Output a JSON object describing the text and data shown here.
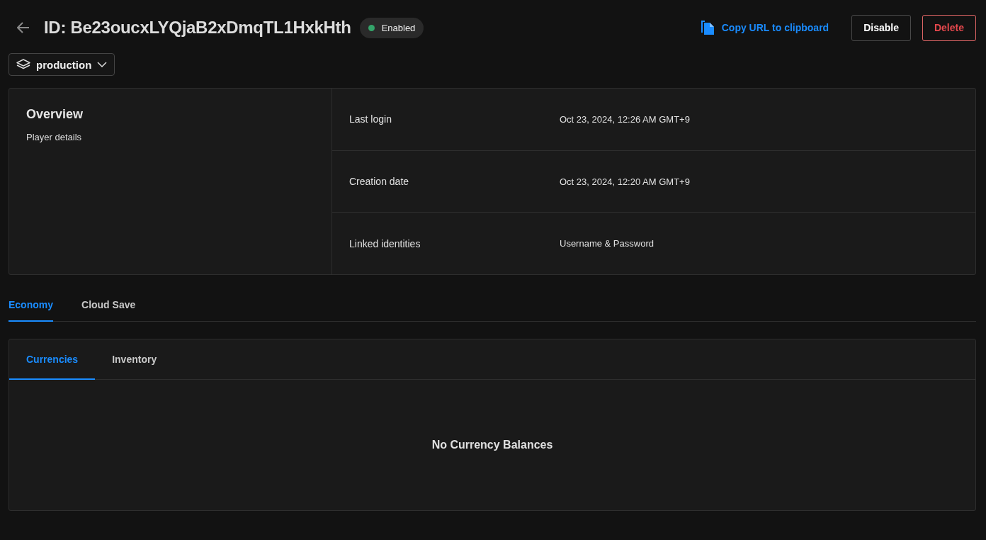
{
  "header": {
    "title": "ID: Be23oucxLYQjaB2xDmqTL1HxkHth",
    "status": {
      "label": "Enabled",
      "color": "#34a46a"
    },
    "copy_link": "Copy URL to clipboard",
    "buttons": [
      {
        "label": "Disable",
        "kind": "default"
      },
      {
        "label": "Delete",
        "kind": "danger"
      }
    ]
  },
  "environment": {
    "value": "production"
  },
  "overview": {
    "title": "Overview",
    "subtitle": "Player details",
    "fields": [
      {
        "label": "Last login",
        "value": "Oct 23, 2024, 12:26 AM GMT+9"
      },
      {
        "label": "Creation date",
        "value": "Oct 23, 2024, 12:20 AM GMT+9"
      },
      {
        "label": "Linked identities",
        "value": "Username & Password"
      }
    ]
  },
  "tabs": [
    {
      "label": "Economy",
      "selected": true
    },
    {
      "label": "Cloud Save",
      "selected": false
    }
  ],
  "subtabs": [
    {
      "label": "Currencies",
      "selected": true
    },
    {
      "label": "Inventory",
      "selected": false
    }
  ],
  "empty_message": "No Currency Balances"
}
